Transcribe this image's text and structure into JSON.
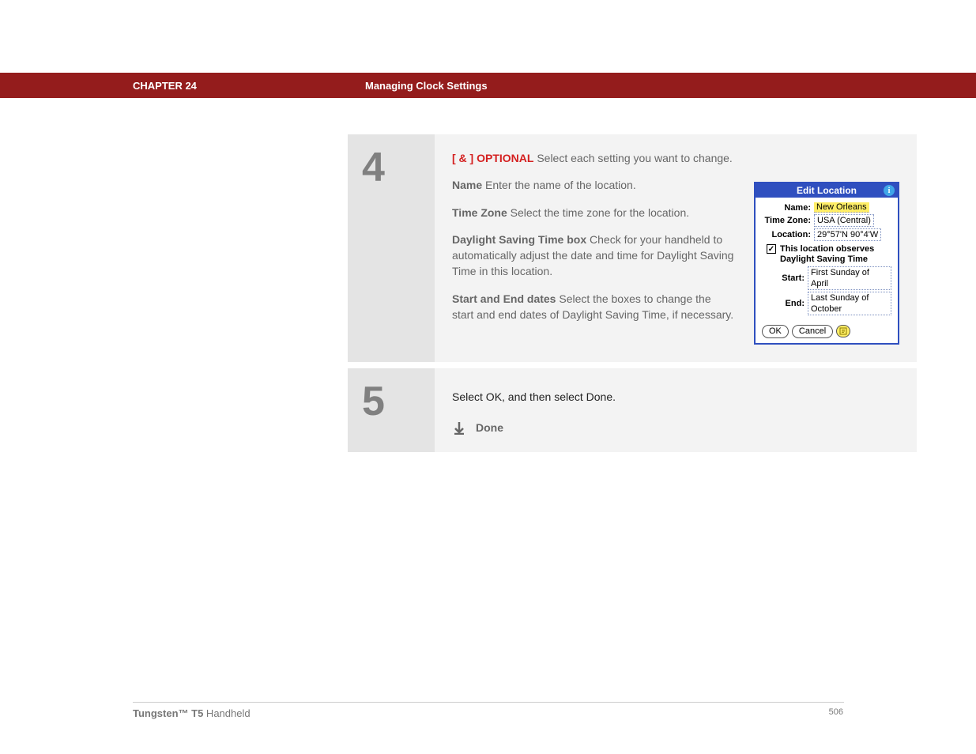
{
  "header": {
    "chapter": "CHAPTER 24",
    "title": "Managing Clock Settings"
  },
  "step4": {
    "number": "4",
    "optional": "[ & ]  OPTIONAL",
    "optional_desc": "   Select each setting you want to change.",
    "name_label": "Name",
    "name_desc": "   Enter the name of the location.",
    "tz_label": "Time Zone",
    "tz_desc": "    Select the time zone for the location.",
    "dst_label": "Daylight Saving Time box",
    "dst_desc": " Check for your handheld to automatically adjust the date and time for Daylight Saving Time in this location.",
    "start_label": "Start and End dates",
    "start_desc": "   Select the boxes to change the start and end dates of Daylight Saving Time, if necessary."
  },
  "palm": {
    "title": "Edit Location",
    "name_label": "Name:",
    "name_value": "New Orleans",
    "tz_label": "Time Zone:",
    "tz_value": "USA (Central)",
    "loc_label": "Location:",
    "loc_value": "29°57'N 90°4'W",
    "check_text": "This location observes Daylight Saving Time",
    "start_label": "Start:",
    "start_value": "First Sunday of April",
    "end_label": "End:",
    "end_value": "Last Sunday of October",
    "ok": "OK",
    "cancel": "Cancel"
  },
  "step5": {
    "number": "5",
    "text": "Select OK, and then select Done.",
    "done": "Done"
  },
  "footer": {
    "product_bold": "Tungsten™ T5",
    "product_rest": " Handheld",
    "page": "506"
  }
}
